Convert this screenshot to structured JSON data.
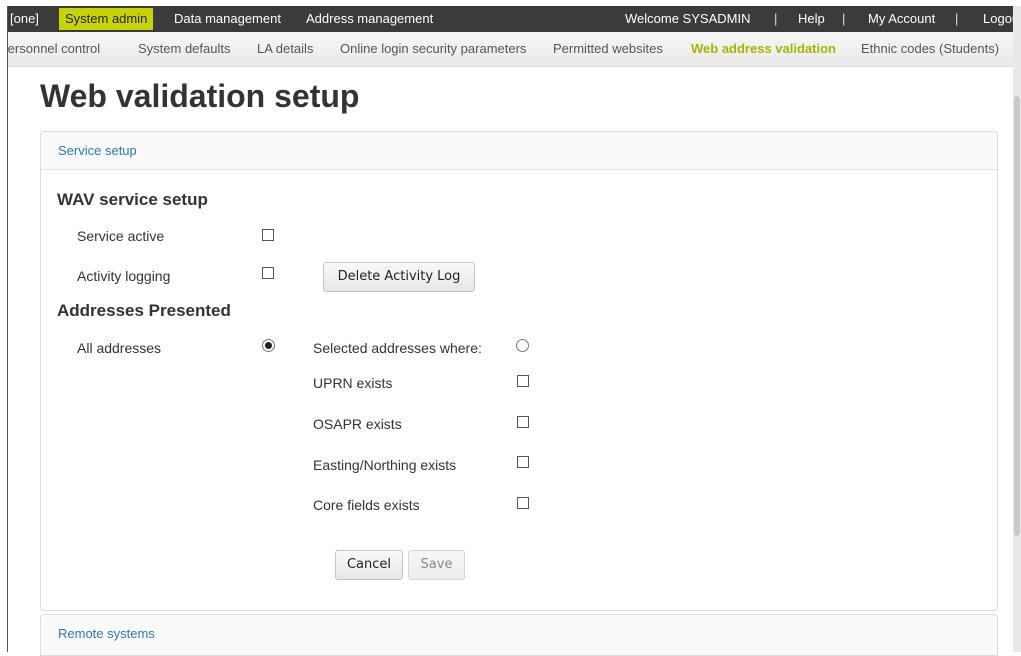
{
  "topnav": {
    "items": [
      "[one]",
      "System admin",
      "Data management",
      "Address management"
    ],
    "welcome": "Welcome SYSADMIN",
    "separator": "|",
    "help": "Help",
    "my_account": "My Account",
    "logout": "Logout",
    "accent_color": "#c8d400"
  },
  "subnav": {
    "items": [
      "Personnel control",
      "System defaults",
      "LA details",
      "Online login security parameters",
      "Permitted websites",
      "Web address validation",
      "Ethnic codes (Students)"
    ],
    "active_color": "#a6b500"
  },
  "page": {
    "title": "Web validation setup"
  },
  "service_setup": {
    "header": "Service setup",
    "wav_heading": "WAV service setup",
    "service_active_label": "Service active",
    "service_active_checked": false,
    "activity_logging_label": "Activity logging",
    "activity_logging_checked": false,
    "delete_log_button": "Delete Activity Log",
    "addresses_heading": "Addresses Presented",
    "all_addresses_label": "All addresses",
    "all_addresses_selected": true,
    "selected_addresses_label": "Selected addresses where:",
    "selected_addresses_selected": false,
    "conditions": [
      {
        "label": "UPRN exists",
        "checked": false
      },
      {
        "label": "OSAPR exists",
        "checked": false
      },
      {
        "label": "Easting/Northing exists",
        "checked": false
      },
      {
        "label": "Core fields exists",
        "checked": false
      }
    ],
    "cancel_button": "Cancel",
    "save_button": "Save"
  },
  "remote_systems": {
    "header": "Remote systems"
  }
}
